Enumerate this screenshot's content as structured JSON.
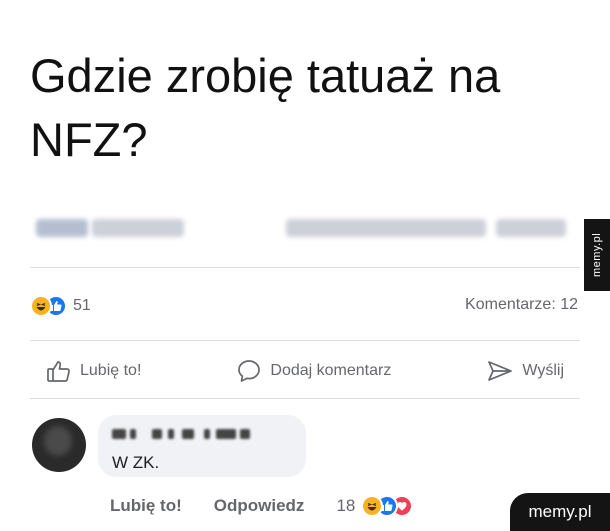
{
  "post": {
    "title": "Gdzie zrobię tatuaż na NFZ?"
  },
  "stats": {
    "reaction_count": "51",
    "comments_label": "Komentarze: 12"
  },
  "actions": {
    "like_label": "Lubię to!",
    "comment_label": "Dodaj komentarz",
    "share_label": "Wyślij"
  },
  "comment": {
    "text": "W ZK.",
    "like_label": "Lubię to!",
    "reply_label": "Odpowiedz",
    "reaction_count": "18"
  },
  "watermarks": {
    "side": "memy.pl",
    "corner": "memy.pl"
  },
  "colors": {
    "haha": "#f7b125",
    "like": "#1877f2",
    "love": "#f33e58",
    "secondary_text": "#65676b"
  },
  "icons": {
    "like": "thumbs-up-icon",
    "comment": "speech-bubble-icon",
    "share": "send-icon"
  }
}
